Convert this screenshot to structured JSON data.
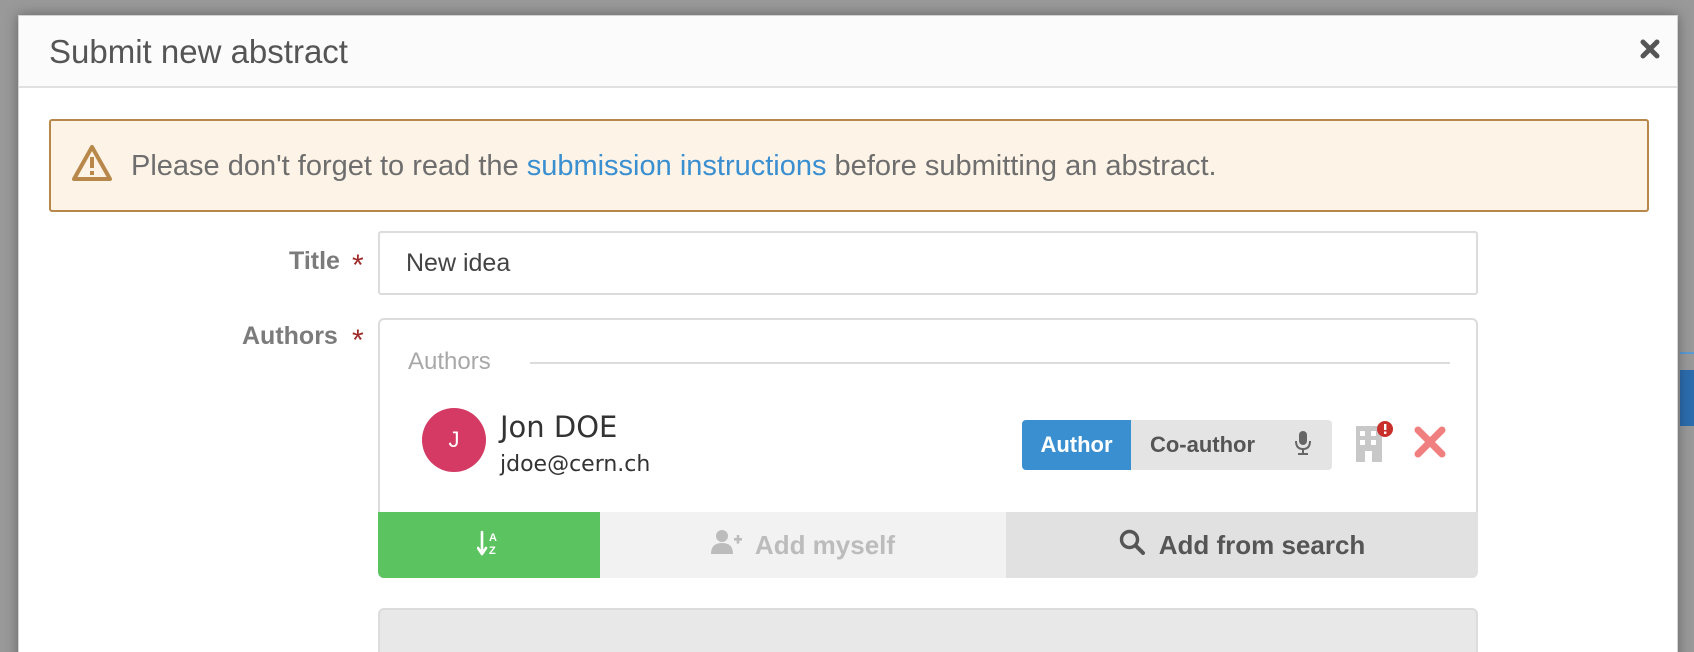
{
  "dialog": {
    "title": "Submit new abstract"
  },
  "alert": {
    "text_before": "Please don't forget to read the ",
    "link_text": "submission instructions",
    "text_after": " before submitting an abstract."
  },
  "form": {
    "title_label": "Title",
    "title_value": "New idea",
    "authors_label": "Authors",
    "required_marker": "*"
  },
  "authors": {
    "legend": "Authors",
    "entries": [
      {
        "initial": "J",
        "name": "Jon DOE",
        "email": "jdoe@cern.ch",
        "avatar_color": "#d43a63"
      }
    ],
    "roles": {
      "author": "Author",
      "coauthor": "Co-author"
    },
    "actions": {
      "add_myself": "Add myself",
      "add_from_search": "Add from search"
    }
  },
  "colors": {
    "primary": "#3a8fd1",
    "success": "#5cc361",
    "danger": "#f07f7f",
    "warning_border": "#b8884a",
    "warning_bg": "#fdf3e6",
    "required": "#9f2a2a"
  }
}
